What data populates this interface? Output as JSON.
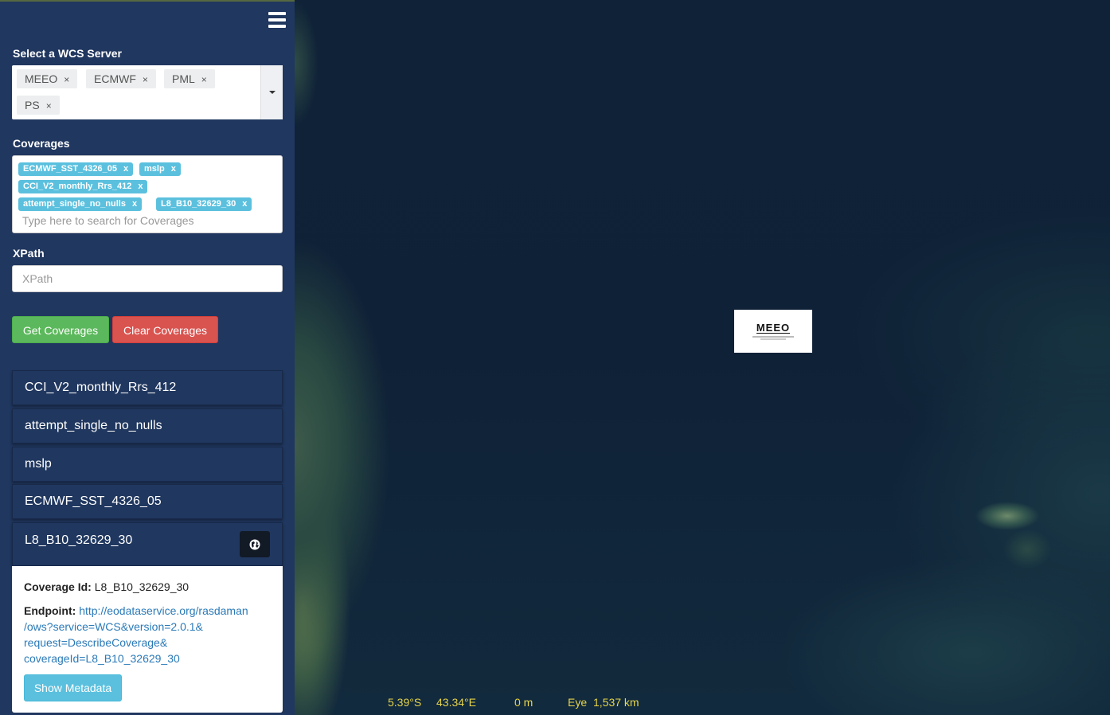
{
  "sidebar": {
    "menu_icon": "hamburger-icon",
    "server_label": "Select a WCS Server",
    "servers": [
      "MEEO",
      "ECMWF",
      "PML",
      "PS"
    ],
    "remove_glyph": "×",
    "coverages_label": "Coverages",
    "selected_coverages": [
      "ECMWF_SST_4326_05",
      "mslp",
      "CCI_V2_monthly_Rrs_412",
      "attempt_single_no_nulls",
      "L8_B10_32629_30"
    ],
    "chip_remove_glyph": "x",
    "coverage_search_placeholder": "Type here to search for Coverages",
    "xpath_label": "XPath",
    "xpath_placeholder": "XPath",
    "get_coverages_label": "Get Coverages",
    "clear_coverages_label": "Clear Coverages",
    "coverage_list": [
      "CCI_V2_monthly_Rrs_412",
      "attempt_single_no_nulls",
      "mslp",
      "ECMWF_SST_4326_05",
      "L8_B10_32629_30"
    ],
    "globe_icon": "globe-icon",
    "detail": {
      "coverage_id_label": "Coverage Id:",
      "coverage_id_value": "L8_B10_32629_30",
      "endpoint_label": "Endpoint:",
      "endpoint_lines": [
        "http://eodataservice.org/rasdaman",
        "/ows?service=WCS&version=2.0.1&",
        "request=DescribeCoverage&",
        "coverageId=L8_B10_32629_30"
      ],
      "show_metadata_label": "Show Metadata"
    }
  },
  "map": {
    "logo_text": "MEEO",
    "status": {
      "lat": "5.39°S",
      "lon": "43.34°E",
      "elevation": "0 m",
      "eye_label": "Eye",
      "eye_value": "1,537 km"
    }
  },
  "colors": {
    "sidebar_bg": "#20375f",
    "success": "#5cb85c",
    "danger": "#d9534f",
    "info": "#5bc0de",
    "status_text": "#e6d44a"
  }
}
